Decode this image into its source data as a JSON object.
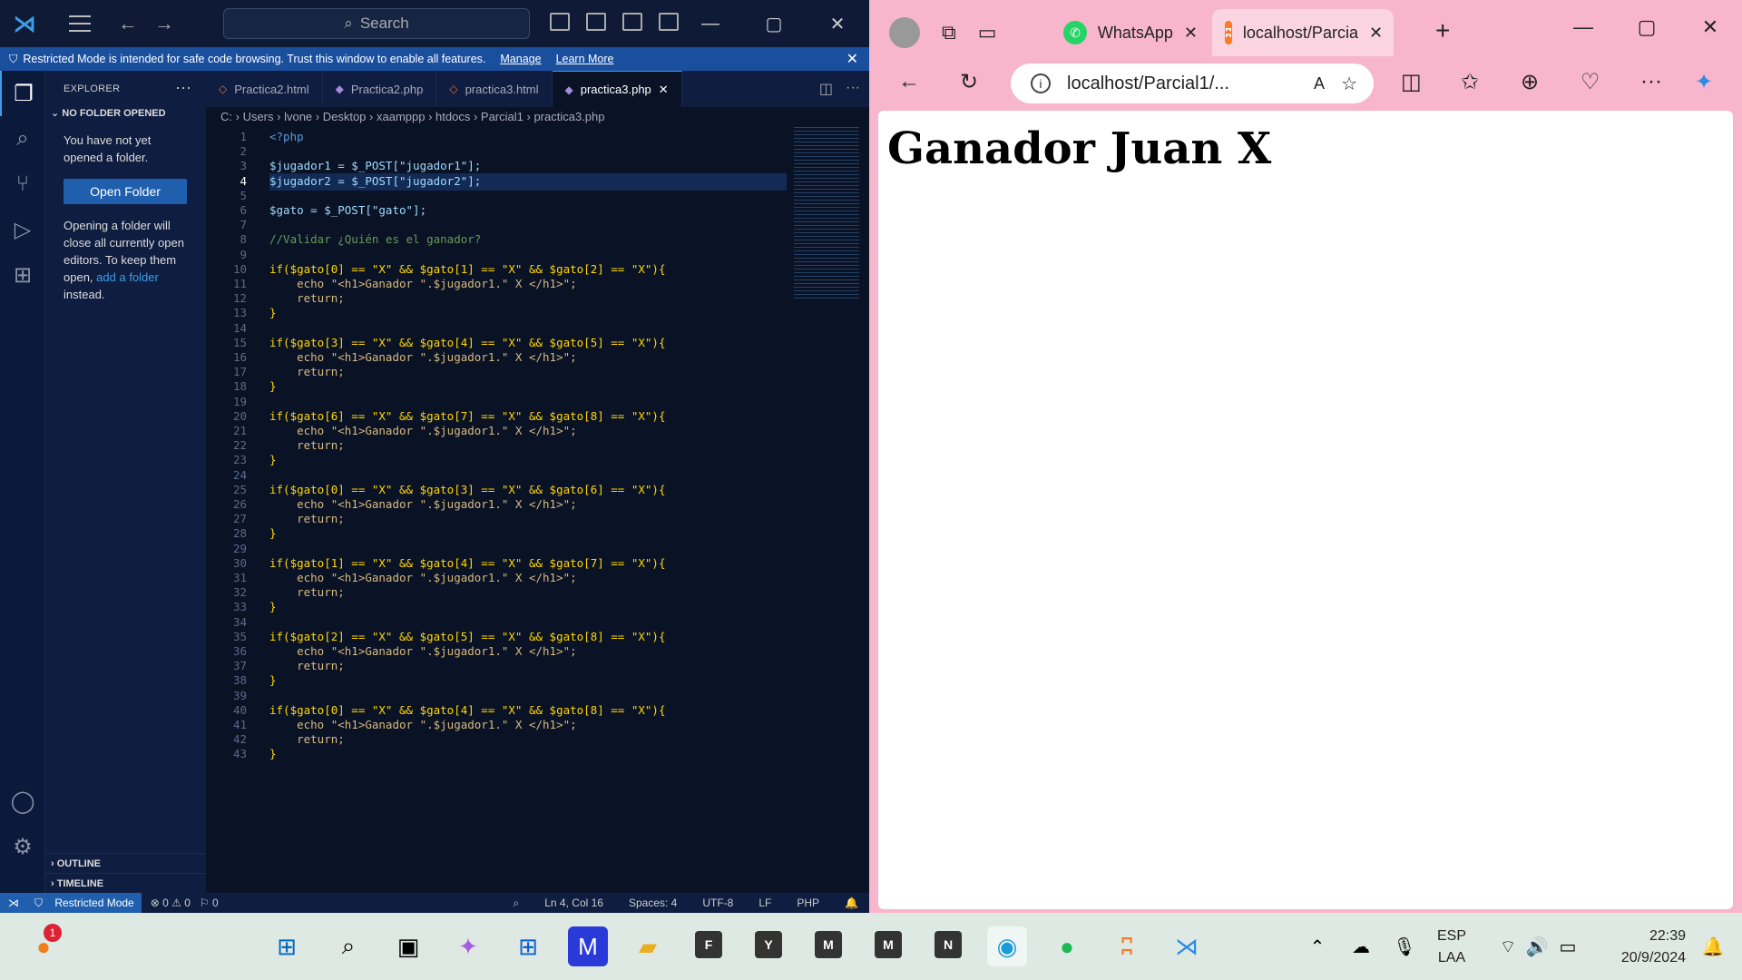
{
  "vscode": {
    "search_placeholder": "Search",
    "banner": {
      "text": "Restricted Mode is intended for safe code browsing. Trust this window to enable all features.",
      "manage": "Manage",
      "learn_more": "Learn More"
    },
    "explorer": {
      "title": "EXPLORER",
      "section": "NO FOLDER OPENED",
      "msg1": "You have not yet opened a folder.",
      "open_folder": "Open Folder",
      "msg2_a": "Opening a folder will close all currently open editors. To keep them open,",
      "msg2_link": "add a folder",
      "msg2_b": "instead.",
      "outline": "OUTLINE",
      "timeline": "TIMELINE"
    },
    "tabs": [
      {
        "label": "Practica2.html",
        "kind": "html"
      },
      {
        "label": "Practica2.php",
        "kind": "php"
      },
      {
        "label": "practica3.html",
        "kind": "html"
      },
      {
        "label": "practica3.php",
        "kind": "php",
        "active": true
      }
    ],
    "breadcrumb": [
      "C:",
      "Users",
      "lvone",
      "Desktop",
      "xaamppp",
      "htdocs",
      "Parcial1",
      "practica3.php"
    ],
    "current_line": 4,
    "code": [
      "<?php",
      "",
      "$jugador1 = $_POST[\"jugador1\"];",
      "$jugador2 = $_POST[\"jugador2\"];",
      "",
      "$gato = $_POST[\"gato\"];",
      "",
      "//Validar ¿Quién es el ganador?",
      "",
      "if($gato[0] == \"X\" && $gato[1] == \"X\" && $gato[2] == \"X\"){",
      "    echo \"<h1>Ganador \".$jugador1.\" X </h1>\";",
      "    return;",
      "}",
      "",
      "if($gato[3] == \"X\" && $gato[4] == \"X\" && $gato[5] == \"X\"){",
      "    echo \"<h1>Ganador \".$jugador1.\" X </h1>\";",
      "    return;",
      "}",
      "",
      "if($gato[6] == \"X\" && $gato[7] == \"X\" && $gato[8] == \"X\"){",
      "    echo \"<h1>Ganador \".$jugador1.\" X </h1>\";",
      "    return;",
      "}",
      "",
      "if($gato[0] == \"X\" && $gato[3] == \"X\" && $gato[6] == \"X\"){",
      "    echo \"<h1>Ganador \".$jugador1.\" X </h1>\";",
      "    return;",
      "}",
      "",
      "if($gato[1] == \"X\" && $gato[4] == \"X\" && $gato[7] == \"X\"){",
      "    echo \"<h1>Ganador \".$jugador1.\" X </h1>\";",
      "    return;",
      "}",
      "",
      "if($gato[2] == \"X\" && $gato[5] == \"X\" && $gato[8] == \"X\"){",
      "    echo \"<h1>Ganador \".$jugador1.\" X </h1>\";",
      "    return;",
      "}",
      "",
      "if($gato[0] == \"X\" && $gato[4] == \"X\" && $gato[8] == \"X\"){",
      "    echo \"<h1>Ganador \".$jugador1.\" X </h1>\";",
      "    return;",
      "}"
    ],
    "status": {
      "mode": "Restricted Mode",
      "errors": "0",
      "warnings": "0",
      "ports": "0",
      "position": "Ln 4, Col 16",
      "spaces": "Spaces: 4",
      "encoding": "UTF-8",
      "eol": "LF",
      "lang": "PHP"
    }
  },
  "browser": {
    "tabs": [
      {
        "label": "WhatsApp"
      },
      {
        "label": "localhost/Parcia"
      }
    ],
    "url": "localhost/Parcial1/...",
    "heading": "Ganador Juan X"
  },
  "taskbar": {
    "notif_count": "1",
    "letters": [
      "F",
      "Y",
      "M",
      "M",
      "N"
    ],
    "lang_top": "ESP",
    "lang_bottom": "LAA",
    "time": "22:39",
    "date": "20/9/2024"
  },
  "colors": {
    "vscode_bg": "#0b1a3a",
    "accent": "#3c9ee6",
    "browser_frame": "#f8b6cc",
    "taskbar": "#dfe9e4"
  }
}
